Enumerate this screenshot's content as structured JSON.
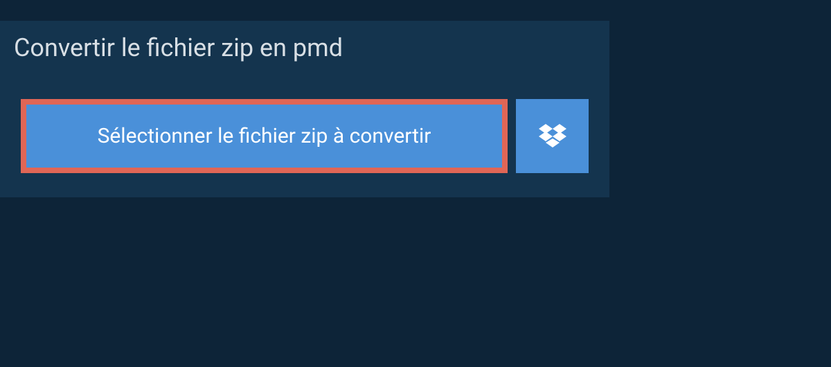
{
  "title": "Convertir le fichier zip en pmd",
  "buttons": {
    "select_file": "Sélectionner le fichier zip à convertir"
  },
  "colors": {
    "background": "#0d2438",
    "panel": "#14344e",
    "button": "#4a90d9",
    "highlight_border": "#e06656",
    "text_light": "#d8dfe5",
    "text_white": "#ffffff"
  }
}
